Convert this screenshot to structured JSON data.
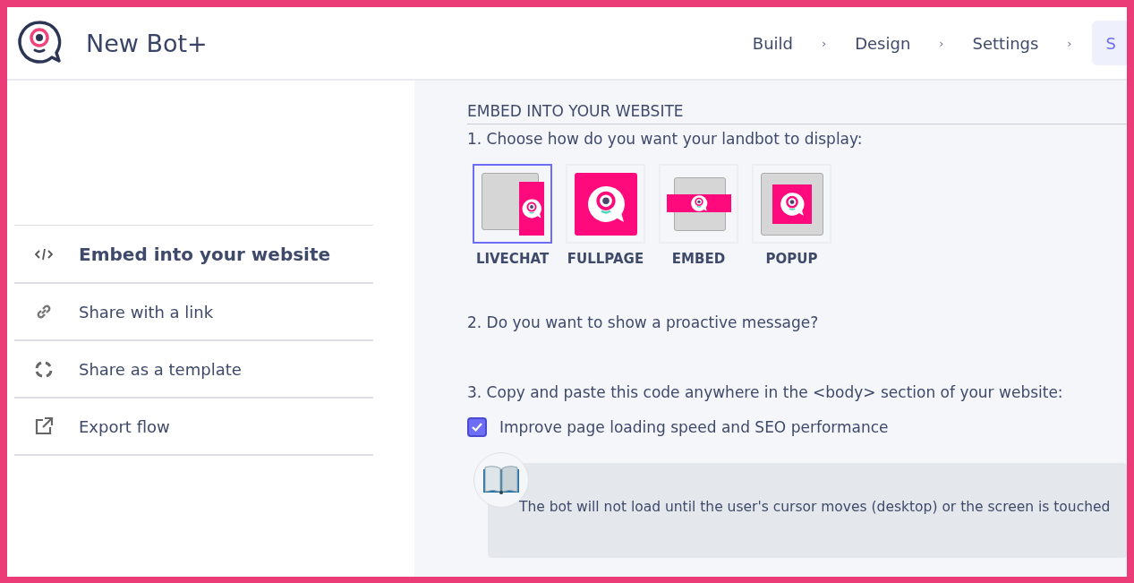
{
  "header": {
    "title": "New Bot+",
    "steps": [
      {
        "label": "Build",
        "selected": false
      },
      {
        "label": "Design",
        "selected": false
      },
      {
        "label": "Settings",
        "selected": false
      },
      {
        "label": "S",
        "selected": true
      }
    ],
    "separator": "›"
  },
  "sidebar": {
    "items": [
      {
        "label": "Embed into your website",
        "selected": true
      },
      {
        "label": "Share with a link",
        "selected": false
      },
      {
        "label": "Share as a template",
        "selected": false
      },
      {
        "label": "Export flow",
        "selected": false
      }
    ]
  },
  "content": {
    "heading": "EMBED INTO YOUR WEBSITE",
    "step_1": "1. Choose how do you want your landbot to display:",
    "display_options": [
      {
        "label": "LIVECHAT",
        "kind": "livechat",
        "selected": true
      },
      {
        "label": "FULLPAGE",
        "kind": "fullpage",
        "selected": false
      },
      {
        "label": "EMBED",
        "kind": "embed",
        "selected": false
      },
      {
        "label": "POPUP",
        "kind": "popup",
        "selected": false
      }
    ],
    "step_2": "2. Do you want to show a proactive message?",
    "step_3": "3. Copy and paste this code anywhere in the <body> section of your website:",
    "speed_option": {
      "label": "Improve page loading speed and SEO performance",
      "checked": true
    },
    "info_note": "The bot will not load until the user's cursor moves (desktop) or the screen is touched"
  }
}
